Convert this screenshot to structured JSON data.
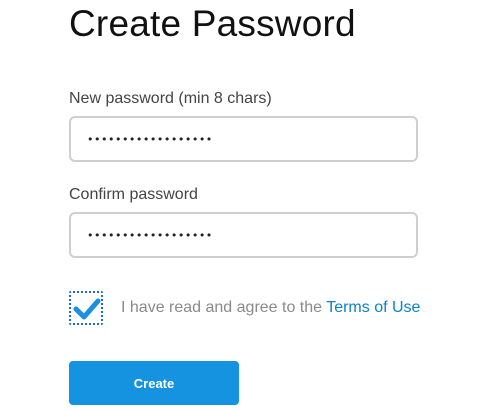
{
  "page": {
    "title": "Create Password"
  },
  "form": {
    "new_password_label": "New password (min 8 chars)",
    "new_password_value": "••••••••••••••••••",
    "confirm_password_label": "Confirm password",
    "confirm_password_value": "••••••••••••••••••",
    "agree_checked": true,
    "agree_text": "I have read and agree to the ",
    "terms_link_text": "Terms of Use",
    "create_button_label": "Create"
  },
  "colors": {
    "accent": "#1592e0",
    "link": "#0a84c6",
    "checkmark": "#1a8fe3",
    "field_border": "#cfcfcf"
  },
  "icons": {
    "checkbox_mark": "checkmark-icon"
  }
}
